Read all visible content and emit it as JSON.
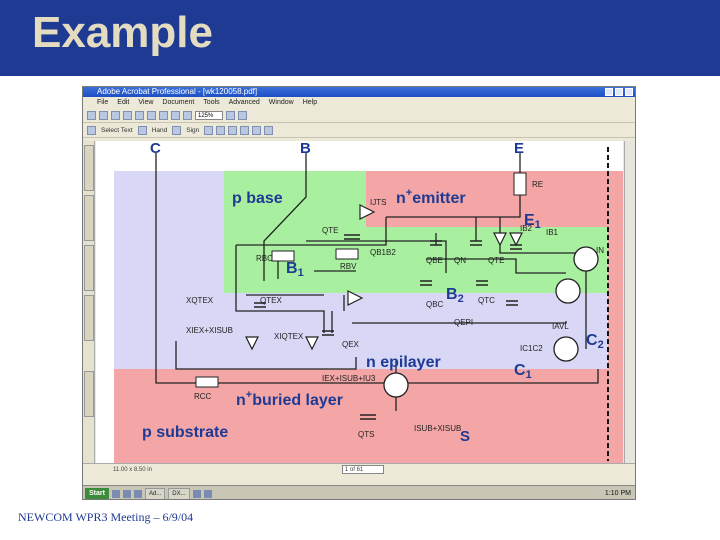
{
  "slide": {
    "title": "Example",
    "footer": "NEWCOM WPR3 Meeting – 6/9/04"
  },
  "window": {
    "title": "Adobe Acrobat Professional - [wk120058.pdf]",
    "menu": [
      "File",
      "Edit",
      "View",
      "Document",
      "Tools",
      "Advanced",
      "Window",
      "Help"
    ],
    "toolbar1": {
      "zoom": "125%"
    },
    "toolbar2": {
      "select_text": "Select Text",
      "hand": "Hand",
      "sign": "Sign"
    }
  },
  "document": {
    "terminals": {
      "c": "C",
      "b": "B",
      "e": "E",
      "s": "S"
    },
    "regions": {
      "p_base": "p base",
      "n_emitter": "n",
      "n_emitter_sup": "+",
      "n_emitter_rest": "emitter",
      "n_epilayer": "n epilayer",
      "n_buried": "n",
      "n_buried_sup": "+",
      "n_buried_rest": "buried layer",
      "p_substrate": "p substrate"
    },
    "nodes": {
      "e1": "E",
      "e1_sub": "1",
      "b1": "B",
      "b1_sub": "1",
      "b2": "B",
      "b2_sub": "2",
      "c1": "C",
      "c1_sub": "1",
      "c2": "C",
      "c2_sub": "2"
    },
    "components": {
      "re": "RE",
      "rbc": "RBC",
      "rbv": "RBV",
      "rcc": "RCC",
      "qte_s": "QTE",
      "qb1b2": "QB1B2",
      "qbe": "QBE",
      "qn": "QN",
      "qte": "QTE",
      "qbc": "QBC",
      "qtc": "QTC",
      "qepi": "QEPI",
      "qex": "QEX",
      "qts": "QTS",
      "ijts": "IJTS",
      "ib2": "IB2",
      "ib1": "IB1",
      "in": "IN",
      "xqtex": "XQTEX",
      "qtex": "QTEX",
      "xiex_xisub": "XIEX+XISUB",
      "xiqtex": "XIQTEX",
      "iavl": "IAVL",
      "icle2": "IC1C2",
      "iex_isub_iu3": "IEX+ISUB+IU3",
      "isub_xisub": "ISUB+XISUB"
    }
  },
  "status": {
    "page": "1 of 61",
    "size": "11.00 x 8.50 in"
  },
  "taskbar": {
    "start": "Start",
    "tasks": [
      "Ad...",
      "DX..."
    ],
    "clock": "1:10 PM"
  },
  "colors": {
    "header": "#1f3a93",
    "title": "#e4dcc0",
    "red_region": "#f4a6a6",
    "green_region": "#a8f0a0",
    "blue_region": "#d8d8f6",
    "label_blue": "#1f3a93"
  }
}
